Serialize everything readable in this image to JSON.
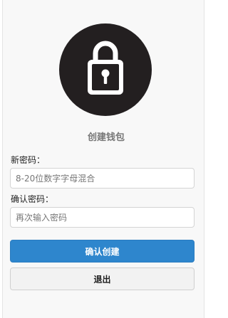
{
  "brand": {
    "icon": "lock-icon",
    "title": "创建钱包",
    "circle_color": "#231f20"
  },
  "form": {
    "new_password_label": "新密码：",
    "new_password_placeholder": "8-20位数字字母混合",
    "new_password_value": "",
    "confirm_password_label": "确认密码：",
    "confirm_password_placeholder": "再次输入密码",
    "confirm_password_value": ""
  },
  "actions": {
    "confirm_label": "确认创建",
    "confirm_color": "#2e86cd",
    "exit_label": "退出"
  }
}
